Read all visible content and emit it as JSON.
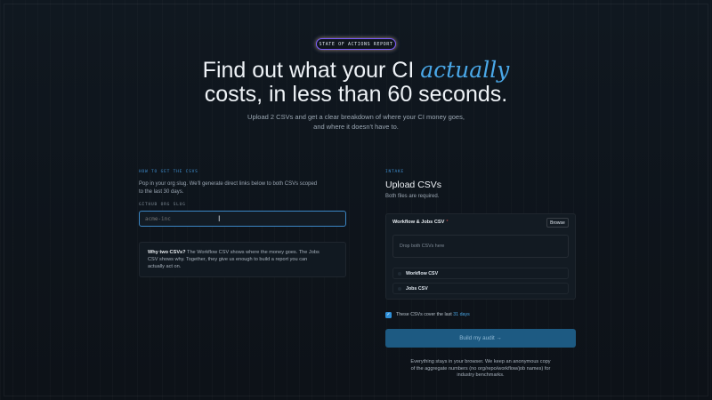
{
  "hero": {
    "badge": "STATE OF ACTIONS REPORT",
    "title_line1_pre": "Find out what your CI ",
    "title_accent": "actually",
    "title_line2": "costs, in less than 60 seconds.",
    "sub_line1": "Upload 2 CSVs and get a clear breakdown of where your CI money goes,",
    "sub_line2": "and where it doesn't have to."
  },
  "left": {
    "section_label": "HOW TO GET THE CSVS",
    "desc_line1": "Pop in your org slug. We'll generate direct links below to both CSVs scoped",
    "desc_line2": "to the last 30 days.",
    "input_label": "GITHUB ORG SLUG",
    "input_placeholder": "acme-inc",
    "info_bold": "Why two CSVs?",
    "info_line1": " The Workflow CSV shows where the money goes. The Jobs",
    "info_line2": "CSV shows why. Together, they give us enough to build a report you can",
    "info_line3": "actually act on."
  },
  "right": {
    "section_label": "INTAKE",
    "title": "Upload CSVs",
    "required_note": "Both files are required.",
    "card_title": "Workflow & Jobs CSV",
    "required_mark": "*",
    "browse_label": "Browse",
    "dropzone_text": "Drop both CSVs here",
    "files": [
      "Workflow CSV",
      "Jobs CSV"
    ],
    "checkbox_label": "These CSVs cover the last",
    "checkbox_link": "31 days",
    "checkbox_checked": true,
    "build_button": "Build my audit →",
    "foot_line1": "Everything stays in your browser. We keep an anonymous copy",
    "foot_line2": "of the aggregate numbers (no org/repo/workflow/job names) for",
    "foot_line3": "industry benchmarks."
  },
  "colors": {
    "accent": "#4aa8e8",
    "button": "#1d5a82",
    "background": "#0f151c"
  }
}
